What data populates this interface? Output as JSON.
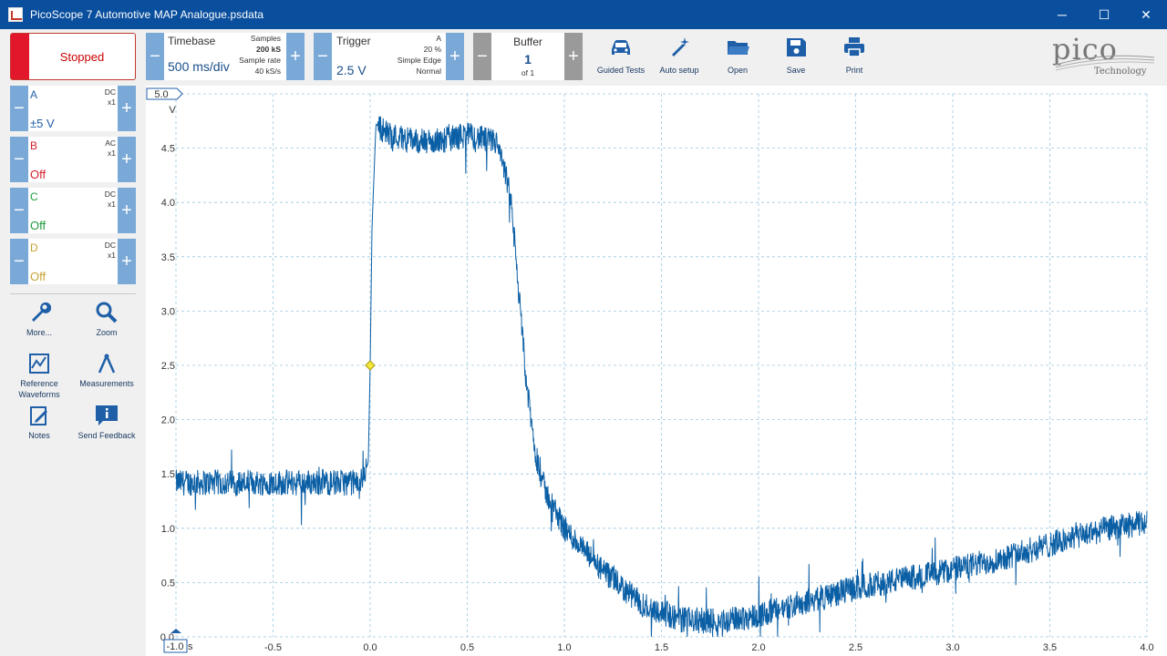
{
  "window": {
    "title": "PicoScope 7 Automotive MAP Analogue.psdata",
    "minimize": "─",
    "maximize": "☐",
    "close": "✕"
  },
  "toolbar": {
    "run_state": "Stopped",
    "timebase": {
      "title": "Timebase",
      "value": "500 ms/div",
      "samples_label": "Samples",
      "samples_value": "200 kS",
      "rate_label": "Sample rate",
      "rate_value": "40 kS/s"
    },
    "trigger": {
      "title": "Trigger",
      "value": "2.5 V",
      "channel": "A",
      "pretrigger": "20 %",
      "type": "Simple Edge",
      "mode": "Normal"
    },
    "buffer": {
      "title": "Buffer",
      "value": "1",
      "of": "of 1"
    },
    "tools": [
      {
        "label": "Guided Tests",
        "icon": "car-icon"
      },
      {
        "label": "Auto setup",
        "icon": "wand-icon"
      },
      {
        "label": "Open",
        "icon": "folder-icon"
      },
      {
        "label": "Save",
        "icon": "floppy-icon"
      },
      {
        "label": "Print",
        "icon": "printer-icon"
      }
    ],
    "logo": {
      "word": "pico",
      "sub": "Technology"
    }
  },
  "channels": [
    {
      "name": "A",
      "coupling": "DC",
      "probe": "x1",
      "range": "±5 V",
      "color": "#1f5fa8"
    },
    {
      "name": "B",
      "coupling": "AC",
      "probe": "x1",
      "range": "Off",
      "color": "#d0202e"
    },
    {
      "name": "C",
      "coupling": "DC",
      "probe": "x1",
      "range": "Off",
      "color": "#1e9a3c"
    },
    {
      "name": "D",
      "coupling": "DC",
      "probe": "x1",
      "range": "Off",
      "color": "#c8a232"
    }
  ],
  "side_tools": [
    {
      "label": "More...",
      "icon": "wrench-icon"
    },
    {
      "label": "Zoom",
      "icon": "magnifier-icon"
    },
    {
      "label": "Reference Waveforms",
      "icon": "reference-waveforms-icon"
    },
    {
      "label": "Measurements",
      "icon": "measurements-icon"
    },
    {
      "label": "Notes",
      "icon": "notes-icon"
    },
    {
      "label": "Send Feedback",
      "icon": "feedback-icon"
    }
  ],
  "chart_data": {
    "type": "line",
    "x_unit": "s",
    "y_unit": "V",
    "xlim": [
      -1.0,
      4.0
    ],
    "ylim": [
      0.0,
      5.0
    ],
    "x_ticks": [
      "-1.0",
      "-0.5",
      "0.0",
      "0.5",
      "1.0",
      "1.5",
      "2.0",
      "2.5",
      "3.0",
      "3.5",
      "4.0"
    ],
    "y_ticks": [
      "0.0",
      "0.5",
      "1.0",
      "1.5",
      "2.0",
      "2.5",
      "3.0",
      "3.5",
      "4.0",
      "4.5",
      "5.0"
    ],
    "trigger_point": {
      "x": 0.0,
      "y": 2.5
    },
    "series": [
      {
        "color": "#0b5fa5",
        "x": [
          -1.0,
          -0.5,
          -0.05,
          -0.01,
          0.0,
          0.01,
          0.03,
          0.1,
          0.3,
          0.5,
          0.65,
          0.72,
          0.76,
          0.8,
          0.85,
          0.9,
          1.0,
          1.2,
          1.4,
          1.6,
          1.8,
          2.0,
          2.2,
          2.5,
          2.8,
          3.0,
          3.2,
          3.5,
          3.8,
          4.0
        ],
        "y": [
          1.42,
          1.42,
          1.42,
          1.6,
          2.5,
          3.8,
          4.72,
          4.62,
          4.55,
          4.62,
          4.55,
          4.1,
          3.3,
          2.4,
          1.7,
          1.35,
          1.0,
          0.6,
          0.3,
          0.16,
          0.14,
          0.2,
          0.3,
          0.45,
          0.55,
          0.62,
          0.7,
          0.85,
          1.0,
          1.05
        ],
        "noise_amplitude_v": 0.12
      }
    ]
  }
}
